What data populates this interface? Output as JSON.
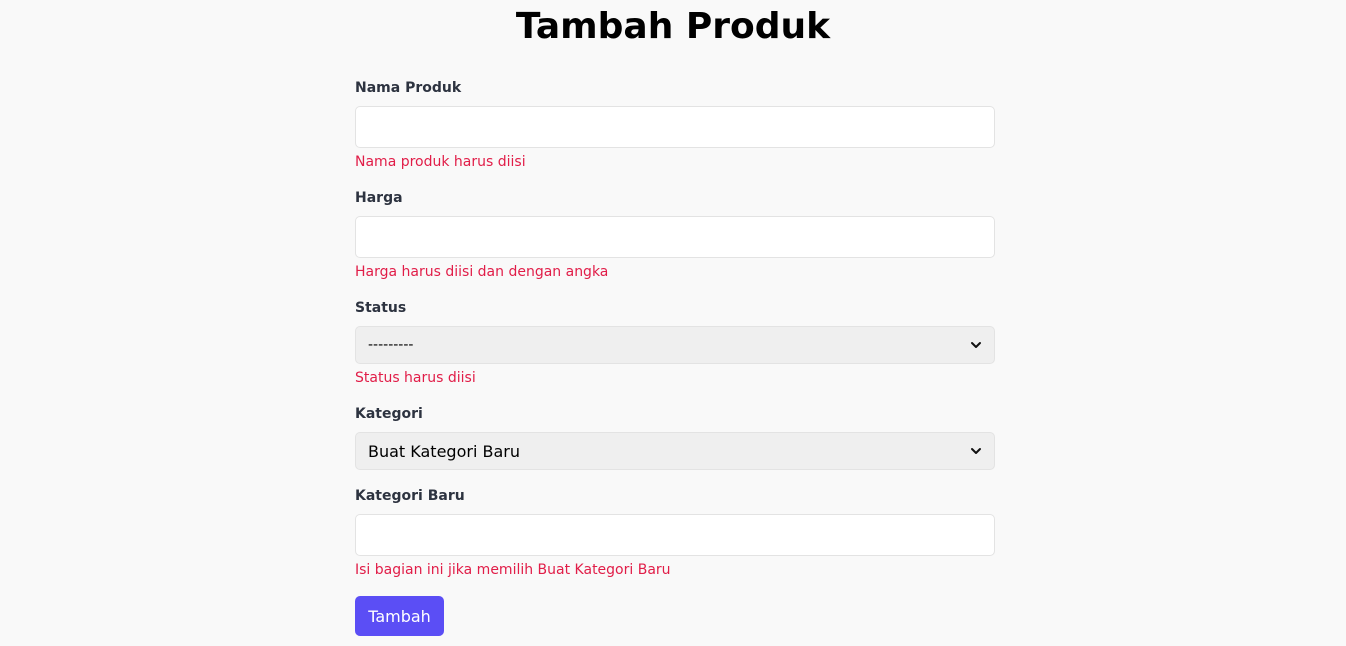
{
  "page": {
    "title": "Tambah Produk"
  },
  "form": {
    "nama_produk": {
      "label": "Nama Produk",
      "value": "",
      "error": "Nama produk harus diisi"
    },
    "harga": {
      "label": "Harga",
      "value": "",
      "error": "Harga harus diisi dan dengan angka"
    },
    "status": {
      "label": "Status",
      "selected": "---------",
      "error": "Status harus diisi"
    },
    "kategori": {
      "label": "Kategori",
      "selected": "Buat Kategori Baru"
    },
    "kategori_baru": {
      "label": "Kategori Baru",
      "value": "",
      "error": "Isi bagian ini jika memilih Buat Kategori Baru"
    },
    "submit_label": "Tambah"
  },
  "colors": {
    "background": "#f9f9f9",
    "error": "#e11d48",
    "primary_button": "#5b4ef5",
    "label": "#2d3340"
  },
  "icons": {
    "select_arrow": "chevron-down-icon"
  }
}
